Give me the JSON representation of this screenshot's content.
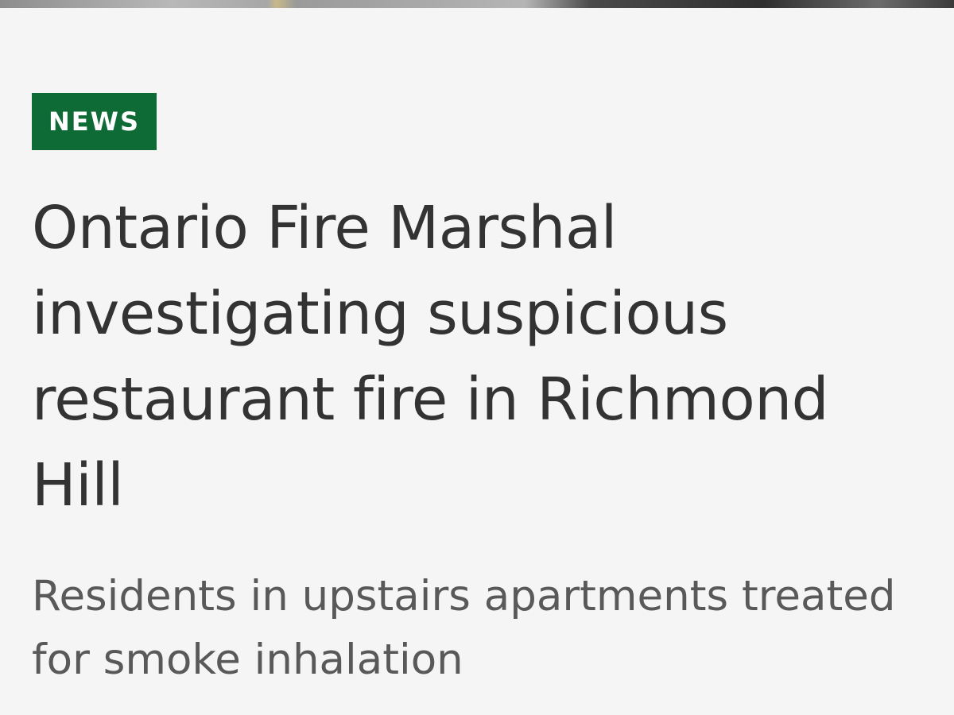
{
  "article": {
    "category": "NEWS",
    "headline": "Ontario Fire Marshal investigating suspicious restaurant fire in Richmond Hill",
    "subheadline": "Residents in upstairs apartments treated for smoke inhalation"
  },
  "colors": {
    "badge_background": "#0e6b36",
    "badge_text": "#ffffff",
    "headline_text": "#333333",
    "subheadline_text": "#595959",
    "page_background": "#f5f5f5"
  }
}
